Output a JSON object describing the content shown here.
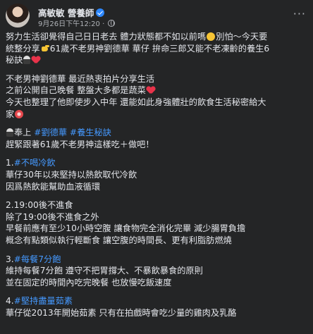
{
  "post": {
    "author": "高敏敏 營養師",
    "timestamp": "9月26日下午12:20",
    "separator": "·",
    "more_label": "···"
  },
  "body": {
    "p1": [
      "努力生活卻覺得自己日日老去 體力狀態都不如以前嗎",
      "別怕～今天要",
      "統整分享",
      "61歲不老男神劉德華 華仔 拚命三郎又能不老凍齡的養生6",
      "秘訣"
    ],
    "p2": [
      "不老男神劉德華 最近熱衷拍片分享生活",
      "之前公開自己晚餐 整盤大多都是蔬菜",
      "今天也整理了他即使步入中年 還能如此身強體壯的飲食生活秘密給大",
      "家"
    ],
    "p3": {
      "prefix": "奉上",
      "tag1": "#劉德華",
      "tag2": "#養生秘訣",
      "line2": "趕緊跟著61歲不老男神這樣吃＋做吧！"
    },
    "s1": {
      "num": "1.",
      "tag": "#不喝冷飲",
      "lines": [
        "華仔30年以來堅持以熱飲取代冷飲",
        "因爲熱飲能幫助血液循環"
      ]
    },
    "s2": {
      "title": "2.19:00後不進食",
      "lines": [
        "除了19:00後不進食之外",
        "早餐前應有至少10小時空腹 讓食物完全消化完畢 減少腸胃負擔",
        "概念有點類似執行輕斷食 讓空腹的時間長、更有利脂肪燃燒"
      ]
    },
    "s3": {
      "num": "3.",
      "tag": "#每餐7分飽",
      "lines": [
        "維持每餐7分飽 遵守不把胃撐大、不暴飲暴食的原則",
        "並在固定的時間內吃完晚餐 也放慢吃飯速度"
      ]
    },
    "s4": {
      "num": "4.",
      "tag": "#堅持盡量茹素",
      "lines": [
        "華仔從2013年開始茹素 只有在拍戲時會吃少量的雞肉及乳酪"
      ]
    }
  },
  "icons": {
    "verified": "verified-badge-icon",
    "audience": "globe-icon",
    "more": "more-options-icon"
  },
  "colors": {
    "background": "#242526",
    "text": "#e4e6eb",
    "secondary": "#b0b3b8",
    "link": "#4599ff",
    "verified": "#2d88ff"
  }
}
